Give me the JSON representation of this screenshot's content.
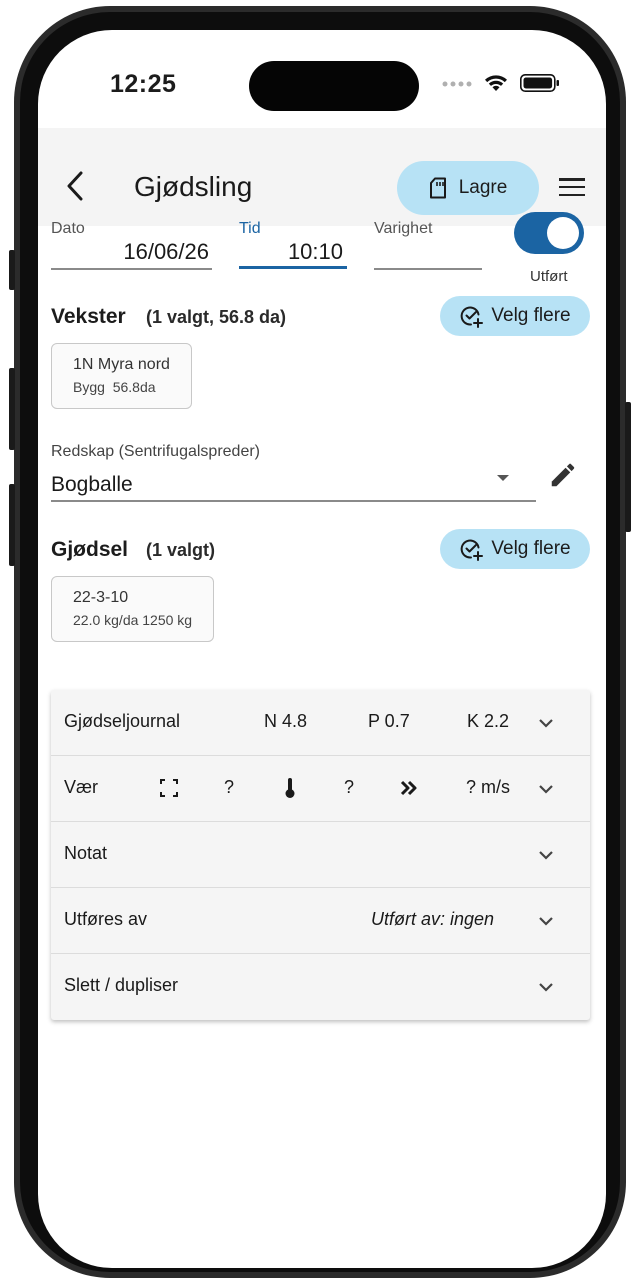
{
  "status_bar": {
    "time": "12:25"
  },
  "app_bar": {
    "back_icon": "chevron-left-icon",
    "title": "Gjødsling",
    "save_label": "Lagre",
    "save_icon": "sd-card-icon",
    "menu_icon": "hamburger-menu-icon"
  },
  "date_fields": {
    "dato": {
      "label": "Dato",
      "value": "16/06/26"
    },
    "tid": {
      "label": "Tid",
      "value": "10:10"
    },
    "varighet": {
      "label": "Varighet",
      "value": ""
    }
  },
  "toggle": {
    "label": "Utført",
    "on": true
  },
  "vekster": {
    "title": "Vekster",
    "subtitle": "(1 valgt, 56.8 da)",
    "button_label": "Velg flere",
    "chip": {
      "name": "1N Myra nord",
      "detail": "Bygg  56.8da"
    }
  },
  "redskap": {
    "label": "Redskap (Sentrifugalspreder)",
    "value": "Bogballe"
  },
  "gjodsel": {
    "title": "Gjødsel",
    "subtitle": "(1 valgt)",
    "button_label": "Velg flere",
    "chip": {
      "name": "22-3-10",
      "detail": "22.0 kg/da 1250 kg"
    }
  },
  "accordion": {
    "journal": {
      "title": "Gjødseljournal",
      "n": "N 4.8",
      "p": "P 0.7",
      "k": "K 2.2"
    },
    "weather": {
      "title": "Vær",
      "cloud": "?",
      "temperature": "?",
      "wind": "? m/s"
    },
    "notat": {
      "title": "Notat"
    },
    "utfores": {
      "title": "Utføres av",
      "value": "Utført av: ingen"
    },
    "slett": {
      "title": "Slett / dupliser"
    }
  },
  "colors": {
    "accent": "#1b64a3",
    "pill": "#b7e2f5",
    "app_bar": "#f4f4f4",
    "tid_label": "#1b64a3"
  }
}
